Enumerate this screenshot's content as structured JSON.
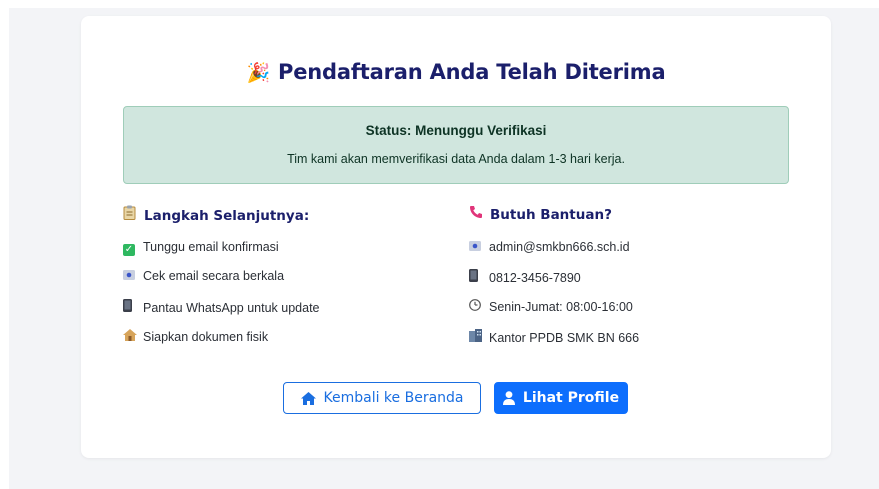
{
  "header": {
    "title": "Pendaftaran Anda Telah Diterima",
    "title_icon": "party-popper-icon"
  },
  "status": {
    "title": "Status: Menunggu Verifikasi",
    "text": "Tim kami akan memverifikasi data Anda dalam 1-3 hari kerja.",
    "bg_color": "#d0e6de"
  },
  "next_steps": {
    "heading": "Langkah Selanjutnya:",
    "heading_icon": "clipboard-icon",
    "items": [
      {
        "label": "Tunggu email konfirmasi",
        "icon": "check-icon"
      },
      {
        "label": "Cek email secara berkala",
        "icon": "email-icon"
      },
      {
        "label": "Pantau WhatsApp untuk update",
        "icon": "phone-icon"
      },
      {
        "label": "Siapkan dokumen fisik",
        "icon": "house-icon"
      }
    ]
  },
  "help": {
    "heading": "Butuh Bantuan?",
    "heading_icon": "telephone-icon",
    "items": [
      {
        "label": "admin@smkbn666.sch.id",
        "icon": "email-icon"
      },
      {
        "label": "0812-3456-7890",
        "icon": "phone-icon"
      },
      {
        "label": "Senin-Jumat: 08:00-16:00",
        "icon": "clock-icon"
      },
      {
        "label": "Kantor PPDB SMK BN 666",
        "icon": "office-icon"
      }
    ]
  },
  "actions": {
    "home_label": "Kembali ke Beranda",
    "profile_label": "Lihat Profile",
    "accent_color": "#0d6efd"
  }
}
